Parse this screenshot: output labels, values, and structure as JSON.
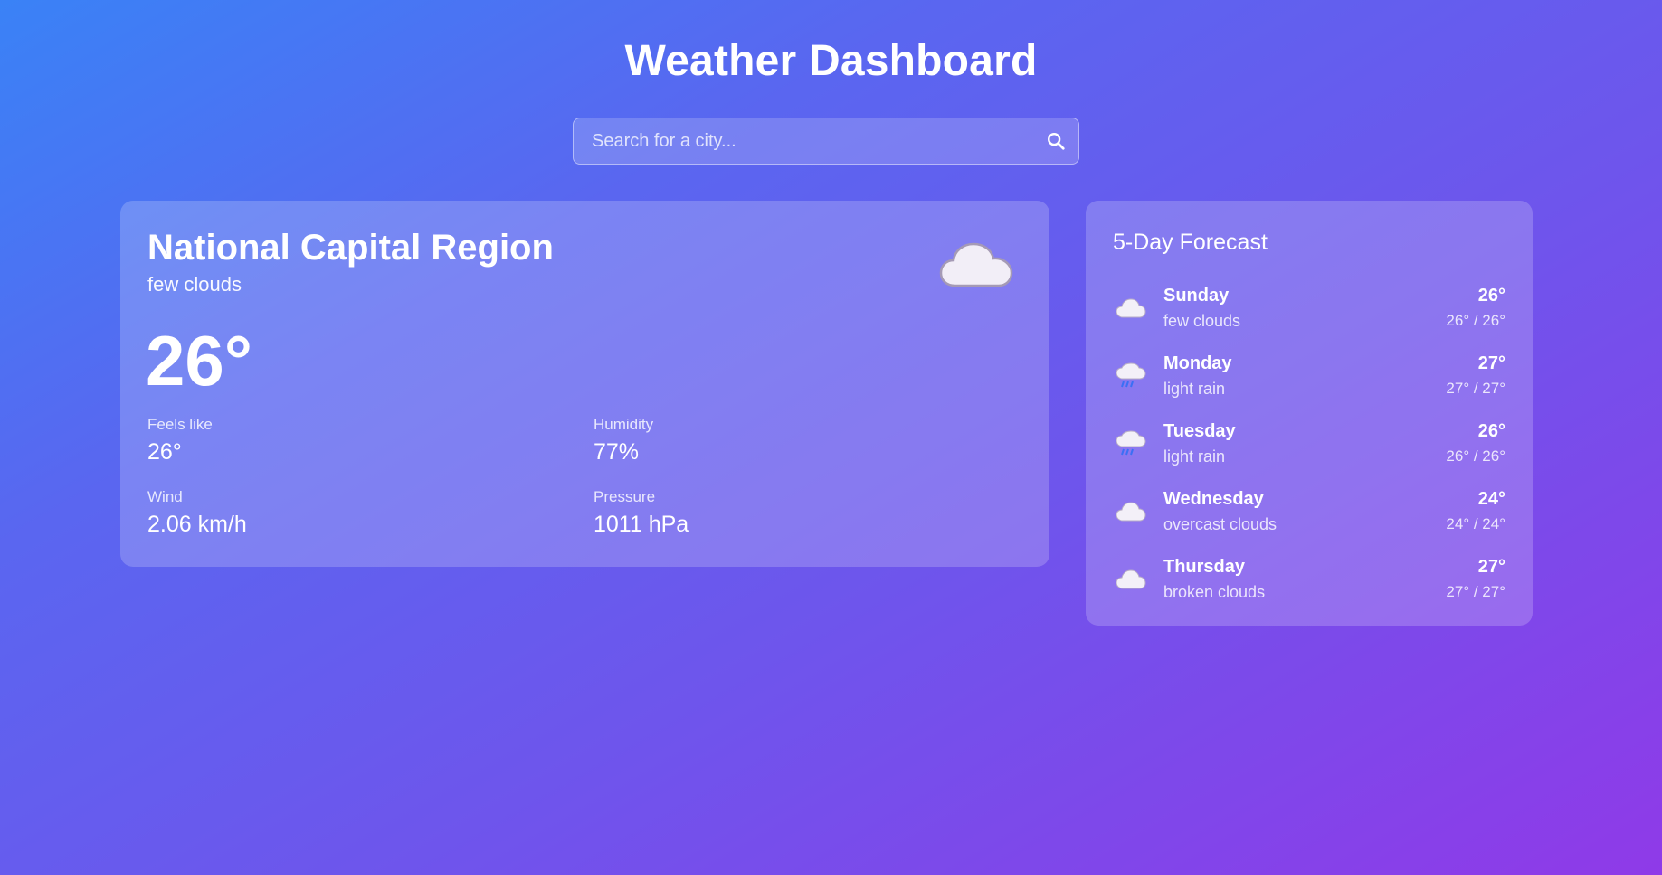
{
  "header": {
    "title": "Weather Dashboard"
  },
  "search": {
    "placeholder": "Search for a city..."
  },
  "current": {
    "city": "National Capital Region",
    "description": "few clouds",
    "temperature": "26°",
    "icon": "cloud-icon",
    "stats": {
      "feels_like": {
        "label": "Feels like",
        "value": "26°"
      },
      "humidity": {
        "label": "Humidity",
        "value": "77%"
      },
      "wind": {
        "label": "Wind",
        "value": "2.06 km/h"
      },
      "pressure": {
        "label": "Pressure",
        "value": "1011 hPa"
      }
    }
  },
  "forecast": {
    "title": "5-Day Forecast",
    "days": [
      {
        "day": "Sunday",
        "desc": "few clouds",
        "temp": "26°",
        "range": "26° / 26°",
        "icon": "cloud-icon"
      },
      {
        "day": "Monday",
        "desc": "light rain",
        "temp": "27°",
        "range": "27° / 27°",
        "icon": "rain-cloud-icon"
      },
      {
        "day": "Tuesday",
        "desc": "light rain",
        "temp": "26°",
        "range": "26° / 26°",
        "icon": "rain-cloud-icon"
      },
      {
        "day": "Wednesday",
        "desc": "overcast clouds",
        "temp": "24°",
        "range": "24° / 24°",
        "icon": "cloud-icon"
      },
      {
        "day": "Thursday",
        "desc": "broken clouds",
        "temp": "27°",
        "range": "27° / 27°",
        "icon": "cloud-icon"
      }
    ]
  },
  "colors": {
    "gradient_start": "#3a82f6",
    "gradient_end": "#8f3ae8",
    "rain": "#3b6ff5"
  }
}
